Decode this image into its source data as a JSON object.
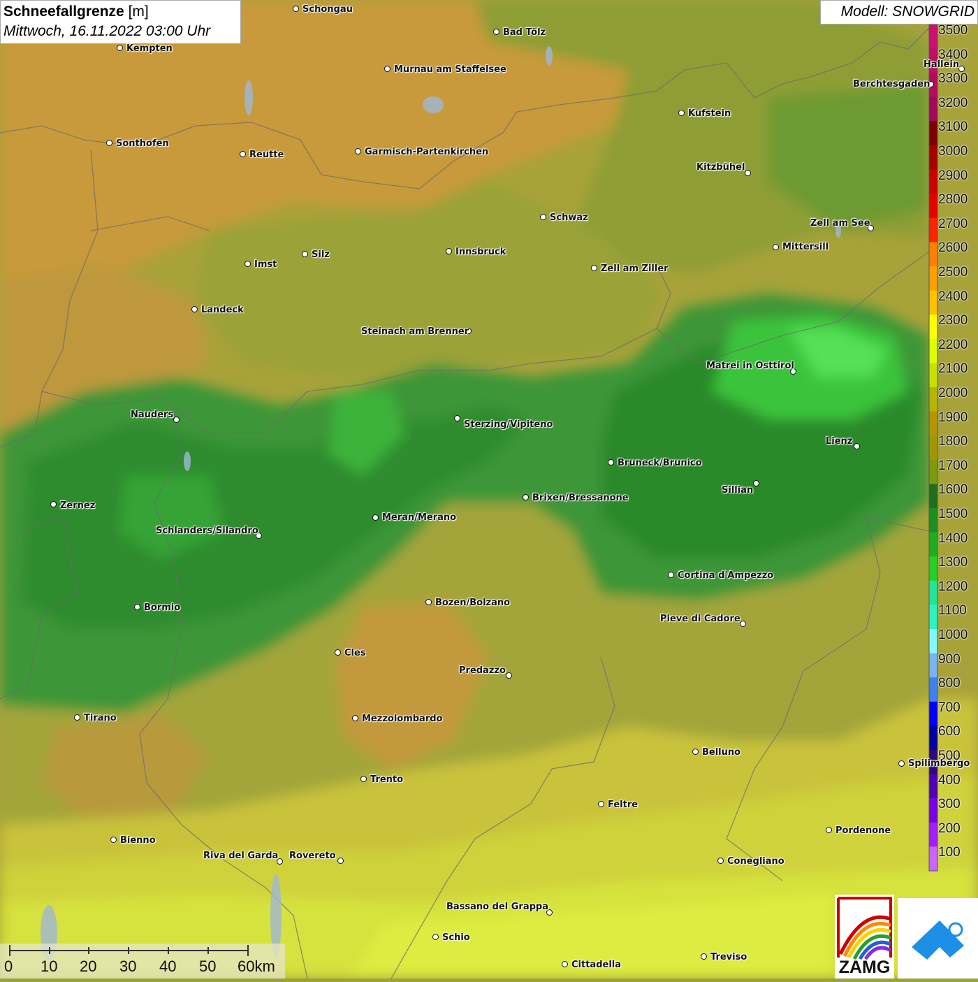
{
  "header": {
    "title": "Schneefallgrenze",
    "unit": "[m]",
    "datetime": "Mittwoch, 16.11.2022 03:00 Uhr",
    "model": "Modell: SNOWGRID"
  },
  "legend": {
    "steps": [
      {
        "value": "3500",
        "color": "#cc0f73"
      },
      {
        "value": "3400",
        "color": "#c00d6a"
      },
      {
        "value": "3300",
        "color": "#b30a63"
      },
      {
        "value": "3200",
        "color": "#a3085a"
      },
      {
        "value": "3100",
        "color": "#7b0000"
      },
      {
        "value": "3000",
        "color": "#a50000"
      },
      {
        "value": "2900",
        "color": "#cc0000"
      },
      {
        "value": "2800",
        "color": "#e60000"
      },
      {
        "value": "2700",
        "color": "#ff2300"
      },
      {
        "value": "2600",
        "color": "#ff8000"
      },
      {
        "value": "2500",
        "color": "#ff9f00"
      },
      {
        "value": "2400",
        "color": "#ffc000"
      },
      {
        "value": "2300",
        "color": "#ffff00"
      },
      {
        "value": "2200",
        "color": "#ddff00"
      },
      {
        "value": "2100",
        "color": "#c8e000"
      },
      {
        "value": "2000",
        "color": "#b8b400"
      },
      {
        "value": "1900",
        "color": "#b59600"
      },
      {
        "value": "1800",
        "color": "#a09800"
      },
      {
        "value": "1700",
        "color": "#7f9a10"
      },
      {
        "value": "1600",
        "color": "#1e6f1e"
      },
      {
        "value": "1500",
        "color": "#1f8e1f"
      },
      {
        "value": "1400",
        "color": "#21ad21"
      },
      {
        "value": "1300",
        "color": "#25d025"
      },
      {
        "value": "1200",
        "color": "#22e59a"
      },
      {
        "value": "1100",
        "color": "#2cf2c4"
      },
      {
        "value": "1000",
        "color": "#86f7f7"
      },
      {
        "value": "900",
        "color": "#78b4f0"
      },
      {
        "value": "800",
        "color": "#3c82f0"
      },
      {
        "value": "700",
        "color": "#0000ff"
      },
      {
        "value": "600",
        "color": "#0000a5"
      },
      {
        "value": "500",
        "color": "#2d0a78"
      },
      {
        "value": "400",
        "color": "#5000b4"
      },
      {
        "value": "300",
        "color": "#7800e6"
      },
      {
        "value": "200",
        "color": "#a01eff"
      },
      {
        "value": "100",
        "color": "#c864ff"
      }
    ]
  },
  "cities": [
    {
      "name": "Schongau"
    },
    {
      "name": "Bad Tölz"
    },
    {
      "name": "Kempten"
    },
    {
      "name": "Murnau am Staffelsee"
    },
    {
      "name": "Berchtesgaden"
    },
    {
      "name": "Kufstein"
    },
    {
      "name": "Sonthofen"
    },
    {
      "name": "Reutte"
    },
    {
      "name": "Garmisch-Partenkirchen"
    },
    {
      "name": "Kitzbühel"
    },
    {
      "name": "Schwaz"
    },
    {
      "name": "Zell am See"
    },
    {
      "name": "Mittersill"
    },
    {
      "name": "Innsbruck"
    },
    {
      "name": "Silz"
    },
    {
      "name": "Imst"
    },
    {
      "name": "Zell am Ziller"
    },
    {
      "name": "Landeck"
    },
    {
      "name": "Steinach am Brenner"
    },
    {
      "name": "Matrei in Osttirol"
    },
    {
      "name": "Nauders"
    },
    {
      "name": "Sterzing/Vipiteno"
    },
    {
      "name": "Lienz"
    },
    {
      "name": "Bruneck/Brunico"
    },
    {
      "name": "Sillian"
    },
    {
      "name": "Zernez"
    },
    {
      "name": "Brixen/Bressanone"
    },
    {
      "name": "Meran/Merano"
    },
    {
      "name": "Schlanders/Silandro"
    },
    {
      "name": "Cortina d'Ampezzo"
    },
    {
      "name": "Bozen/Bolzano"
    },
    {
      "name": "Bormio"
    },
    {
      "name": "Pieve di Cadore"
    },
    {
      "name": "Cles"
    },
    {
      "name": "Predazzo"
    },
    {
      "name": "Tirano"
    },
    {
      "name": "Mezzolombardo"
    },
    {
      "name": "Belluno"
    },
    {
      "name": "Spilimbergo"
    },
    {
      "name": "Trento"
    },
    {
      "name": "Feltre"
    },
    {
      "name": "Pordenone"
    },
    {
      "name": "Bienno"
    },
    {
      "name": "Riva del Garda"
    },
    {
      "name": "Rovereto"
    },
    {
      "name": "Conegliano"
    },
    {
      "name": "Bassano del Grappa"
    },
    {
      "name": "Schio"
    },
    {
      "name": "Treviso"
    },
    {
      "name": "Cittadella"
    },
    {
      "name": "Hallein"
    }
  ],
  "scale": {
    "labels": [
      "0",
      "10",
      "20",
      "30",
      "40",
      "50",
      "60km"
    ]
  },
  "logos": {
    "zamg": "ZAMG",
    "zamg_icon": "zamg-rainbow-logo",
    "geosphere_icon": "geosphere-logo"
  }
}
